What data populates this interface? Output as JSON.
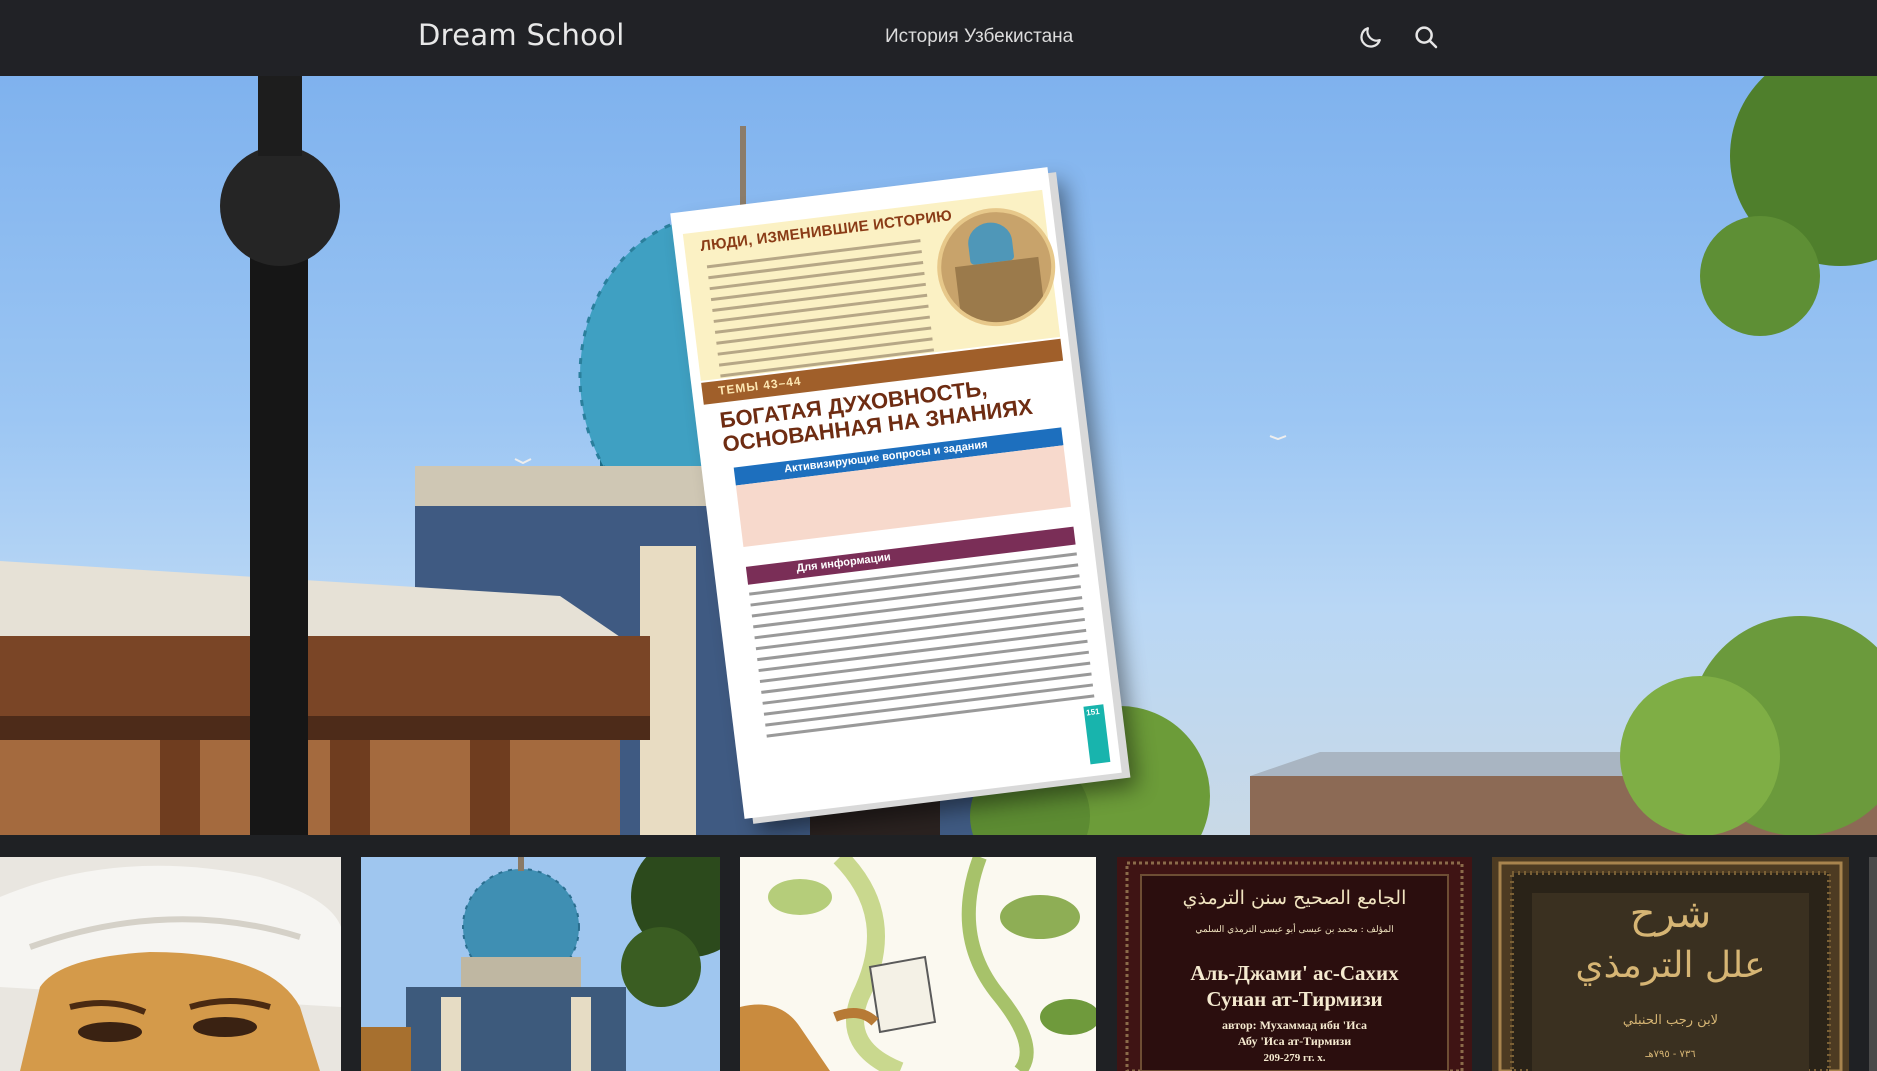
{
  "header": {
    "brand": "Dream School",
    "nav_link": "История Узбекистана",
    "theme_toggle_icon": "moon-icon",
    "search_icon": "search-icon"
  },
  "hero": {
    "book": {
      "box_title": "ЛЮДИ, ИЗМЕНИВШИЕ ИСТОРИЮ",
      "topic_band": "ТЕМЫ 43–44",
      "title_line1": "БОГАТАЯ ДУХОВНОСТЬ,",
      "title_line2": "ОСНОВАННАЯ НА ЗНАНИЯХ",
      "section_questions": "Активизирующие вопросы и задания",
      "section_info": "Для информации",
      "page_number": "151"
    }
  },
  "thumbnails": [
    {
      "id": "portrait"
    },
    {
      "id": "mausoleum"
    },
    {
      "id": "illustration"
    },
    {
      "id": "book-jami",
      "arabic_title": "الجامع الصحيح سنن الترمذي",
      "arabic_author": "المؤلف : محمد بن عيسى أبو عيسى الترمذي السلمي",
      "ru_title_1": "Аль-Джами' ас-Сахих",
      "ru_title_2": "Сунан ат-Тирмизи",
      "ru_author_1": "автор: Мухаммад ибн 'Иса",
      "ru_author_2": "Абу 'Иса ат-Тирмизи",
      "ru_years": "209-279 гг. х."
    },
    {
      "id": "book-sharh",
      "arabic_title_1": "شرح",
      "arabic_title_2": "علل الترمذي",
      "arabic_author": "لابن رجب الحنبلي",
      "arabic_years": "٧٣٦ - ٧٩٥هـ"
    }
  ]
}
